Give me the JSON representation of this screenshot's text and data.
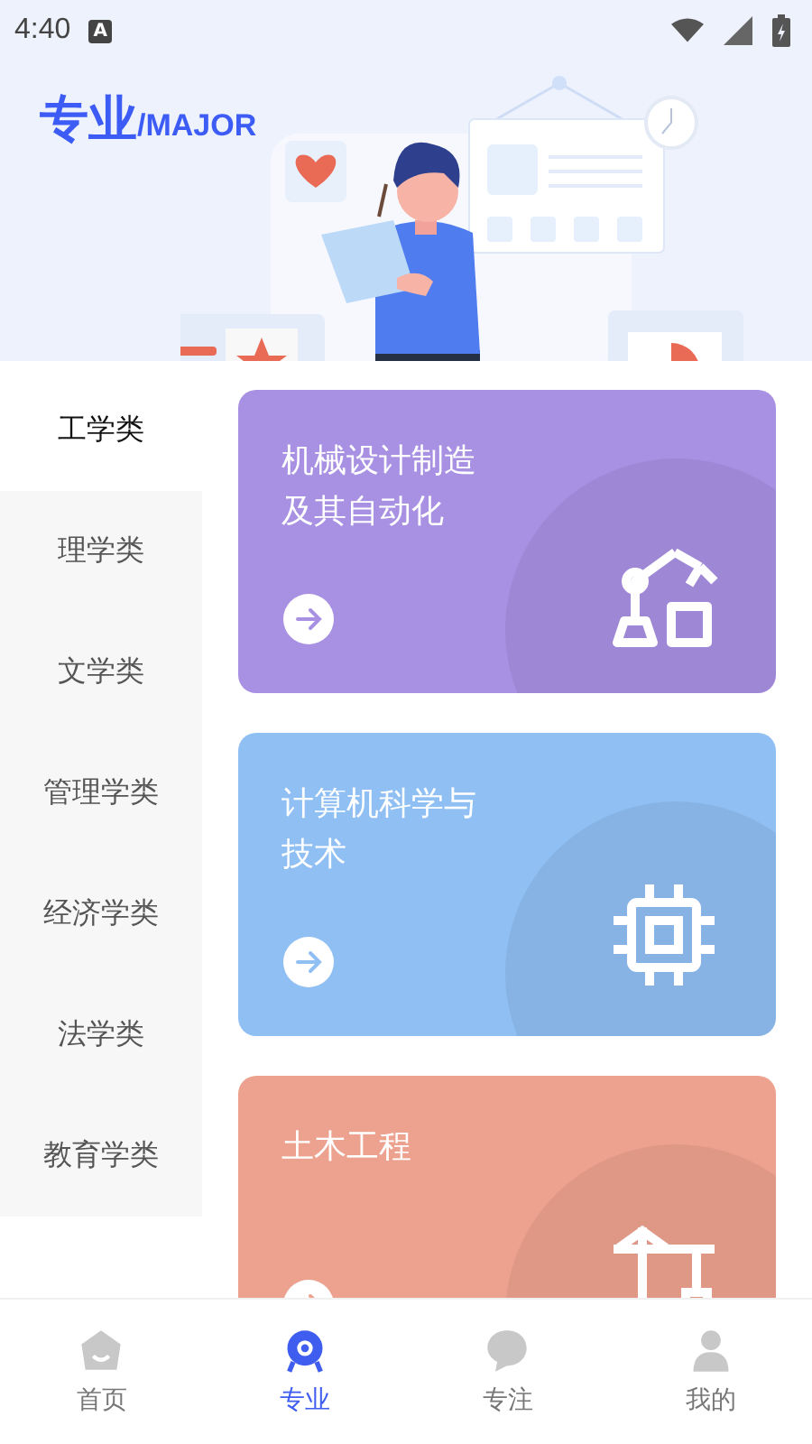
{
  "status_bar": {
    "time": "4:40",
    "notification": "A"
  },
  "header": {
    "title": "专业",
    "subtitle": "/MAJOR"
  },
  "categories": [
    {
      "label": "工学类",
      "selected": true
    },
    {
      "label": "理学类",
      "selected": false
    },
    {
      "label": "文学类",
      "selected": false
    },
    {
      "label": "管理学类",
      "selected": false
    },
    {
      "label": "经济学类",
      "selected": false
    },
    {
      "label": "法学类",
      "selected": false
    },
    {
      "label": "教育学类",
      "selected": false
    }
  ],
  "majors": [
    {
      "title": "机械设计制造及其自动化",
      "kind": "robot",
      "color": "#a890e2"
    },
    {
      "title": "计算机科学与技术",
      "kind": "chip",
      "color": "#8fbff3"
    },
    {
      "title": "土木工程",
      "kind": "crane",
      "color": "#eda28f"
    }
  ],
  "tab_bar": [
    {
      "label": "首页",
      "kind": "home",
      "selected": false
    },
    {
      "label": "专业",
      "kind": "major",
      "selected": true
    },
    {
      "label": "专注",
      "kind": "focus",
      "selected": false
    },
    {
      "label": "我的",
      "kind": "mine",
      "selected": false
    }
  ]
}
